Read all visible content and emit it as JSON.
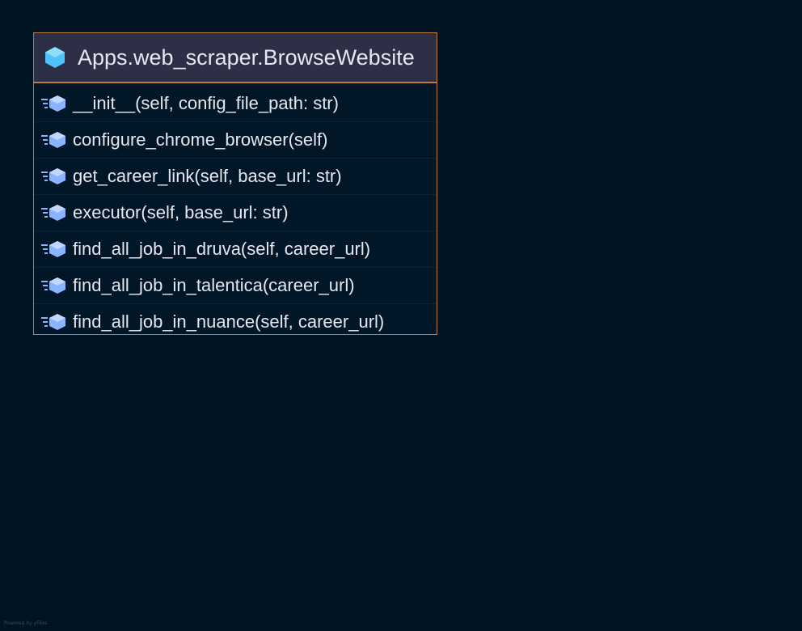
{
  "class_node": {
    "title": "Apps.web_scraper.BrowseWebsite",
    "methods": [
      {
        "label": "__init__(self, config_file_path: str)"
      },
      {
        "label": "configure_chrome_browser(self)"
      },
      {
        "label": "get_career_link(self, base_url: str)"
      },
      {
        "label": "executor(self, base_url: str)"
      },
      {
        "label": "find_all_job_in_druva(self, career_url)"
      },
      {
        "label": "find_all_job_in_talentica(career_url)"
      },
      {
        "label": "find_all_job_in_nuance(self, career_url)"
      }
    ]
  },
  "footer": "Powered by yFiles",
  "colors": {
    "background": "#011423",
    "border": "#c07a3a",
    "class_icon": "#4fc3f7",
    "method_icon": "#8ab4ff"
  }
}
